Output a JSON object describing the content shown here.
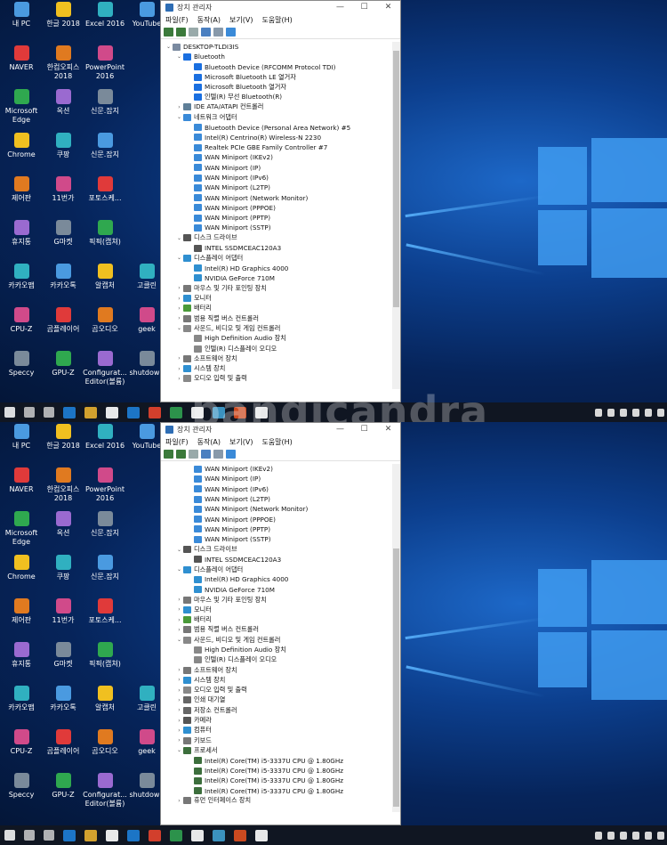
{
  "window": {
    "title": "장치 관리자",
    "menu": [
      "파일(F)",
      "동작(A)",
      "보기(V)",
      "도움말(H)"
    ]
  },
  "desktop_icons": {
    "col1": [
      "내 PC",
      "NAVER",
      "Microsoft Edge",
      "Chrome",
      "제어판",
      "휴지통",
      "카카오맵",
      "CPU-Z",
      "Speccy"
    ],
    "col2": [
      "한글 2018",
      "한컴오피스 2018",
      "옥션",
      "쿠팡",
      "11번가",
      "G마켓",
      "카카오톡",
      "곰플레이어",
      "GPU-Z"
    ],
    "col3": [
      "Excel 2016",
      "PowerPoint 2016",
      "신문.잡지",
      "신문.잡지",
      "포토스케...",
      "픽픽(캡쳐)",
      "알캡처",
      "곰오디오",
      "Configurat... Editor(볼륨)"
    ],
    "col4": [
      "YouTube",
      "",
      "",
      "",
      "",
      "",
      "고클린",
      "geek",
      "shutdown"
    ]
  },
  "tree_top": [
    {
      "lvl": 0,
      "exp": "⌄",
      "t": "DESKTOP-TLDI3IS",
      "c": "#7a8aa0"
    },
    {
      "lvl": 1,
      "exp": "⌄",
      "t": "Bluetooth",
      "c": "#1a6fe0"
    },
    {
      "lvl": 2,
      "exp": "",
      "t": "Bluetooth Device (RFCOMM Protocol TDI)",
      "c": "#1a6fe0"
    },
    {
      "lvl": 2,
      "exp": "",
      "t": "Microsoft Bluetooth LE 열거자",
      "c": "#1a6fe0"
    },
    {
      "lvl": 2,
      "exp": "",
      "t": "Microsoft Bluetooth 열거자",
      "c": "#1a6fe0"
    },
    {
      "lvl": 2,
      "exp": "",
      "t": "인텔(R) 무선 Bluetooth(R)",
      "c": "#1a6fe0"
    },
    {
      "lvl": 1,
      "exp": "›",
      "t": "IDE ATA/ATAPI 컨트롤러",
      "c": "#5f7f98"
    },
    {
      "lvl": 1,
      "exp": "⌄",
      "t": "네트워크 어댑터",
      "c": "#3a8ad8"
    },
    {
      "lvl": 2,
      "exp": "",
      "t": "Bluetooth Device (Personal Area Network) #5",
      "c": "#3a8ad8"
    },
    {
      "lvl": 2,
      "exp": "",
      "t": "Intel(R) Centrino(R) Wireless-N 2230",
      "c": "#3a8ad8"
    },
    {
      "lvl": 2,
      "exp": "",
      "t": "Realtek PCIe GBE Family Controller #7",
      "c": "#3a8ad8"
    },
    {
      "lvl": 2,
      "exp": "",
      "t": "WAN Miniport (IKEv2)",
      "c": "#3a8ad8"
    },
    {
      "lvl": 2,
      "exp": "",
      "t": "WAN Miniport (IP)",
      "c": "#3a8ad8"
    },
    {
      "lvl": 2,
      "exp": "",
      "t": "WAN Miniport (IPv6)",
      "c": "#3a8ad8"
    },
    {
      "lvl": 2,
      "exp": "",
      "t": "WAN Miniport (L2TP)",
      "c": "#3a8ad8"
    },
    {
      "lvl": 2,
      "exp": "",
      "t": "WAN Miniport (Network Monitor)",
      "c": "#3a8ad8"
    },
    {
      "lvl": 2,
      "exp": "",
      "t": "WAN Miniport (PPPOE)",
      "c": "#3a8ad8"
    },
    {
      "lvl": 2,
      "exp": "",
      "t": "WAN Miniport (PPTP)",
      "c": "#3a8ad8"
    },
    {
      "lvl": 2,
      "exp": "",
      "t": "WAN Miniport (SSTP)",
      "c": "#3a8ad8"
    },
    {
      "lvl": 1,
      "exp": "⌄",
      "t": "디스크 드라이브",
      "c": "#555"
    },
    {
      "lvl": 2,
      "exp": "",
      "t": "INTEL SSDMCEAC120A3",
      "c": "#555"
    },
    {
      "lvl": 1,
      "exp": "⌄",
      "t": "디스플레이 어댑터",
      "c": "#2f8fd0"
    },
    {
      "lvl": 2,
      "exp": "",
      "t": "Intel(R) HD Graphics 4000",
      "c": "#2f8fd0"
    },
    {
      "lvl": 2,
      "exp": "",
      "t": "NVIDIA GeForce 710M",
      "c": "#2f8fd0"
    },
    {
      "lvl": 1,
      "exp": "›",
      "t": "마우스 및 기타 포인팅 장치",
      "c": "#777"
    },
    {
      "lvl": 1,
      "exp": "›",
      "t": "모니터",
      "c": "#2f8fd0"
    },
    {
      "lvl": 1,
      "exp": "›",
      "t": "배터리",
      "c": "#4a9a3a"
    },
    {
      "lvl": 1,
      "exp": "›",
      "t": "범용 직렬 버스 컨트롤러",
      "c": "#777"
    },
    {
      "lvl": 1,
      "exp": "⌄",
      "t": "사운드, 비디오 및 게임 컨트롤러",
      "c": "#888"
    },
    {
      "lvl": 2,
      "exp": "",
      "t": "High Definition Audio 장치",
      "c": "#888"
    },
    {
      "lvl": 2,
      "exp": "",
      "t": "인텔(R) 디스플레이 오디오",
      "c": "#888"
    },
    {
      "lvl": 1,
      "exp": "›",
      "t": "소프트웨어 장치",
      "c": "#777"
    },
    {
      "lvl": 1,
      "exp": "›",
      "t": "시스템 장치",
      "c": "#2f8fd0"
    },
    {
      "lvl": 1,
      "exp": "›",
      "t": "오디오 입력 및 출력",
      "c": "#888"
    }
  ],
  "tree_bottom": [
    {
      "lvl": 2,
      "exp": "",
      "t": "WAN Miniport (IKEv2)",
      "c": "#3a8ad8"
    },
    {
      "lvl": 2,
      "exp": "",
      "t": "WAN Miniport (IP)",
      "c": "#3a8ad8"
    },
    {
      "lvl": 2,
      "exp": "",
      "t": "WAN Miniport (IPv6)",
      "c": "#3a8ad8"
    },
    {
      "lvl": 2,
      "exp": "",
      "t": "WAN Miniport (L2TP)",
      "c": "#3a8ad8"
    },
    {
      "lvl": 2,
      "exp": "",
      "t": "WAN Miniport (Network Monitor)",
      "c": "#3a8ad8"
    },
    {
      "lvl": 2,
      "exp": "",
      "t": "WAN Miniport (PPPOE)",
      "c": "#3a8ad8"
    },
    {
      "lvl": 2,
      "exp": "",
      "t": "WAN Miniport (PPTP)",
      "c": "#3a8ad8"
    },
    {
      "lvl": 2,
      "exp": "",
      "t": "WAN Miniport (SSTP)",
      "c": "#3a8ad8"
    },
    {
      "lvl": 1,
      "exp": "⌄",
      "t": "디스크 드라이브",
      "c": "#555"
    },
    {
      "lvl": 2,
      "exp": "",
      "t": "INTEL SSDMCEAC120A3",
      "c": "#555"
    },
    {
      "lvl": 1,
      "exp": "⌄",
      "t": "디스플레이 어댑터",
      "c": "#2f8fd0"
    },
    {
      "lvl": 2,
      "exp": "",
      "t": "Intel(R) HD Graphics 4000",
      "c": "#2f8fd0"
    },
    {
      "lvl": 2,
      "exp": "",
      "t": "NVIDIA GeForce 710M",
      "c": "#2f8fd0"
    },
    {
      "lvl": 1,
      "exp": "›",
      "t": "마우스 및 기타 포인팅 장치",
      "c": "#777"
    },
    {
      "lvl": 1,
      "exp": "›",
      "t": "모니터",
      "c": "#2f8fd0"
    },
    {
      "lvl": 1,
      "exp": "›",
      "t": "배터리",
      "c": "#4a9a3a"
    },
    {
      "lvl": 1,
      "exp": "›",
      "t": "범용 직렬 버스 컨트롤러",
      "c": "#777"
    },
    {
      "lvl": 1,
      "exp": "⌄",
      "t": "사운드, 비디오 및 게임 컨트롤러",
      "c": "#888"
    },
    {
      "lvl": 2,
      "exp": "",
      "t": "High Definition Audio 장치",
      "c": "#888"
    },
    {
      "lvl": 2,
      "exp": "",
      "t": "인텔(R) 디스플레이 오디오",
      "c": "#888"
    },
    {
      "lvl": 1,
      "exp": "›",
      "t": "소프트웨어 장치",
      "c": "#777"
    },
    {
      "lvl": 1,
      "exp": "›",
      "t": "시스템 장치",
      "c": "#2f8fd0"
    },
    {
      "lvl": 1,
      "exp": "›",
      "t": "오디오 입력 및 출력",
      "c": "#888"
    },
    {
      "lvl": 1,
      "exp": "›",
      "t": "인쇄 대기열",
      "c": "#666"
    },
    {
      "lvl": 1,
      "exp": "›",
      "t": "저장소 컨트롤러",
      "c": "#666"
    },
    {
      "lvl": 1,
      "exp": "›",
      "t": "카메라",
      "c": "#555"
    },
    {
      "lvl": 1,
      "exp": "›",
      "t": "컴퓨터",
      "c": "#2f8fd0"
    },
    {
      "lvl": 1,
      "exp": "›",
      "t": "키보드",
      "c": "#777"
    },
    {
      "lvl": 1,
      "exp": "⌄",
      "t": "프로세서",
      "c": "#3c6e3c"
    },
    {
      "lvl": 2,
      "exp": "",
      "t": "Intel(R) Core(TM) i5-3337U CPU @ 1.80GHz",
      "c": "#3c6e3c"
    },
    {
      "lvl": 2,
      "exp": "",
      "t": "Intel(R) Core(TM) i5-3337U CPU @ 1.80GHz",
      "c": "#3c6e3c"
    },
    {
      "lvl": 2,
      "exp": "",
      "t": "Intel(R) Core(TM) i5-3337U CPU @ 1.80GHz",
      "c": "#3c6e3c"
    },
    {
      "lvl": 2,
      "exp": "",
      "t": "Intel(R) Core(TM) i5-3337U CPU @ 1.80GHz",
      "c": "#3c6e3c"
    },
    {
      "lvl": 1,
      "exp": "›",
      "t": "휴먼 인터페이스 장치",
      "c": "#777"
    }
  ],
  "watermark": "bandicandra"
}
